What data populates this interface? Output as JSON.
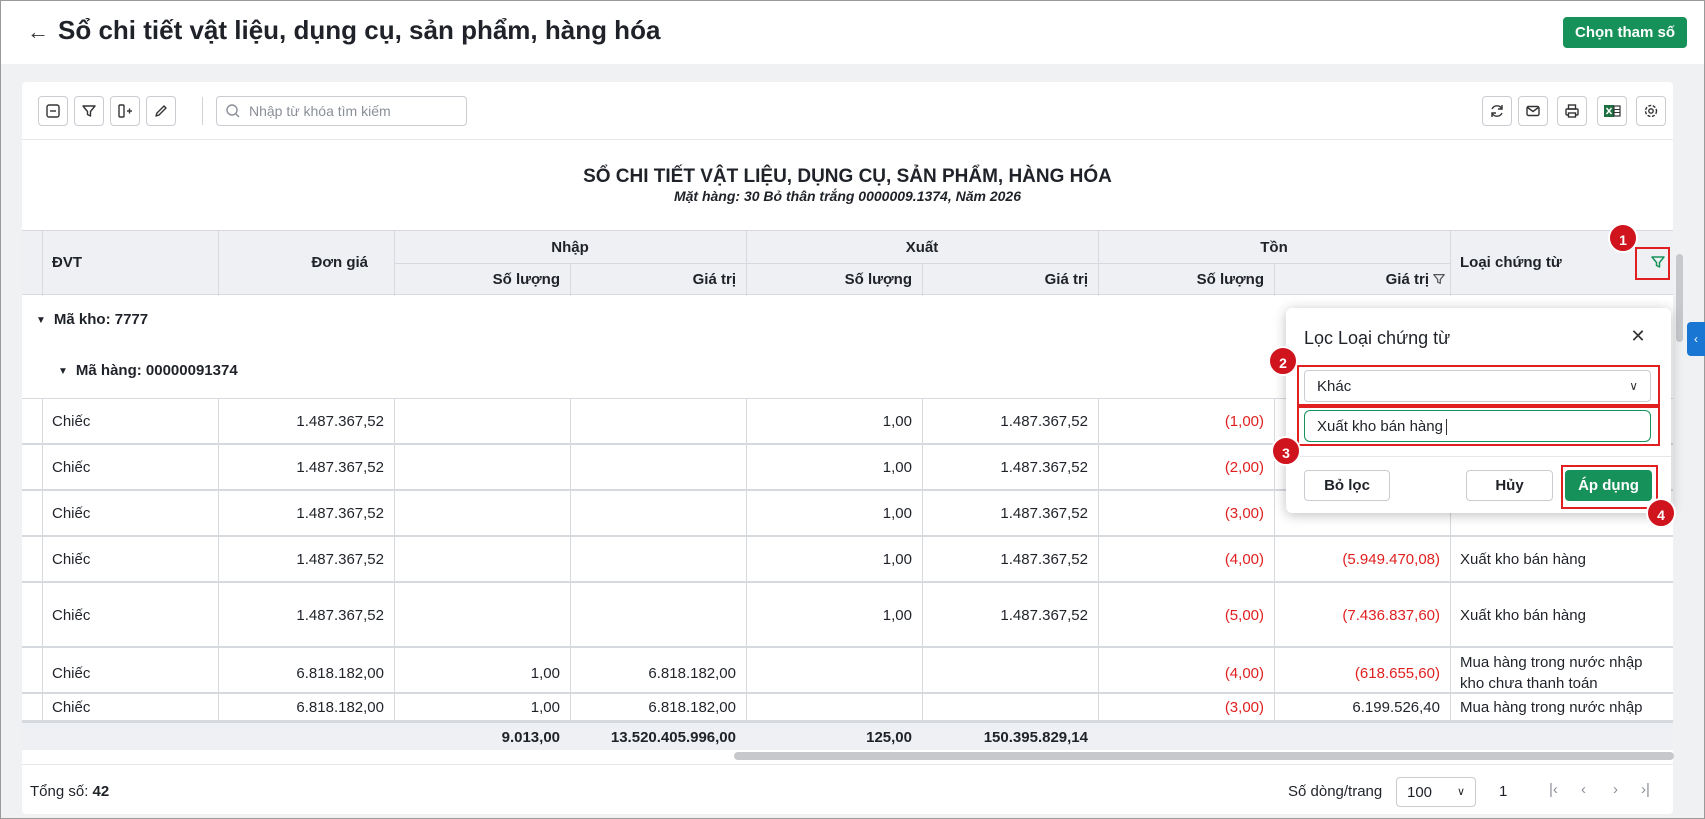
{
  "header": {
    "title": "Sổ chi tiết vật liệu, dụng cụ, sản phẩm, hàng hóa",
    "params_button": "Chọn tham số"
  },
  "toolbar": {
    "search_placeholder": "Nhập từ khóa tìm kiếm"
  },
  "report": {
    "title": "SỔ CHI TIẾT VẬT LIỆU, DỤNG CỤ, SẢN PHẨM, HÀNG HÓA",
    "subtitle": "Mặt hàng: 30 Bỏ thân trắng 0000009.1374, Năm 2026"
  },
  "table": {
    "col_dvt": "ĐVT",
    "col_don_gia": "Đơn giá",
    "group_nhap": "Nhập",
    "group_xuat": "Xuất",
    "group_ton": "Tồn",
    "sub_so_luong": "Số lượng",
    "sub_gia_tri": "Giá trị",
    "col_loai": "Loại chứng từ",
    "group_kho": "Mã kho: 7777",
    "group_hang": "Mã hàng: 00000091374",
    "rows": [
      {
        "dvt": "Chiếc",
        "don_gia": "1.487.367,52",
        "nhap_sl": "",
        "nhap_gt": "",
        "xuat_sl": "1,00",
        "xuat_gt": "1.487.367,52",
        "ton_sl": "(1,00)",
        "ton_gt": "",
        "loai": ""
      },
      {
        "dvt": "Chiếc",
        "don_gia": "1.487.367,52",
        "nhap_sl": "",
        "nhap_gt": "",
        "xuat_sl": "1,00",
        "xuat_gt": "1.487.367,52",
        "ton_sl": "(2,00)",
        "ton_gt": "",
        "loai": ""
      },
      {
        "dvt": "Chiếc",
        "don_gia": "1.487.367,52",
        "nhap_sl": "",
        "nhap_gt": "",
        "xuat_sl": "1,00",
        "xuat_gt": "1.487.367,52",
        "ton_sl": "(3,00)",
        "ton_gt": "",
        "loai": ""
      },
      {
        "dvt": "Chiếc",
        "don_gia": "1.487.367,52",
        "nhap_sl": "",
        "nhap_gt": "",
        "xuat_sl": "1,00",
        "xuat_gt": "1.487.367,52",
        "ton_sl": "(4,00)",
        "ton_gt": "(5.949.470,08)",
        "loai": "Xuất kho bán hàng"
      },
      {
        "dvt": "Chiếc",
        "don_gia": "1.487.367,52",
        "nhap_sl": "",
        "nhap_gt": "",
        "xuat_sl": "1,00",
        "xuat_gt": "1.487.367,52",
        "ton_sl": "(5,00)",
        "ton_gt": "(7.436.837,60)",
        "loai": "Xuất kho bán hàng"
      },
      {
        "dvt": "Chiếc",
        "don_gia": "6.818.182,00",
        "nhap_sl": "1,00",
        "nhap_gt": "6.818.182,00",
        "xuat_sl": "",
        "xuat_gt": "",
        "ton_sl": "(4,00)",
        "ton_gt": "(618.655,60)",
        "loai": "Mua hàng trong nước nhập",
        "loai2": "kho chưa thanh toán"
      },
      {
        "dvt": "Chiếc",
        "don_gia": "6.818.182,00",
        "nhap_sl": "1,00",
        "nhap_gt": "6.818.182,00",
        "xuat_sl": "",
        "xuat_gt": "",
        "ton_sl": "(3,00)",
        "ton_gt": "6.199.526,40",
        "loai": "Mua hàng trong nước nhập"
      }
    ],
    "totals": {
      "nhap_sl": "9.013,00",
      "nhap_gt": "13.520.405.996,00",
      "xuat_sl": "125,00",
      "xuat_gt": "150.395.829,14"
    }
  },
  "footer": {
    "total_label": "Tổng số:",
    "total_value": "42",
    "rows_per_page_label": "Số dòng/trang",
    "rows_per_page": "100",
    "page": "1"
  },
  "filter_popup": {
    "title": "Lọc Loại chứng từ",
    "select_value": "Khác",
    "input_value": "Xuất kho bán hàng",
    "clear_button": "Bỏ lọc",
    "cancel_button": "Hủy",
    "apply_button": "Áp dụng"
  },
  "annotations": [
    "1",
    "2",
    "3",
    "4"
  ],
  "colors": {
    "accent": "#17915a",
    "negative": "#e02020",
    "marker": "#d0141e"
  }
}
